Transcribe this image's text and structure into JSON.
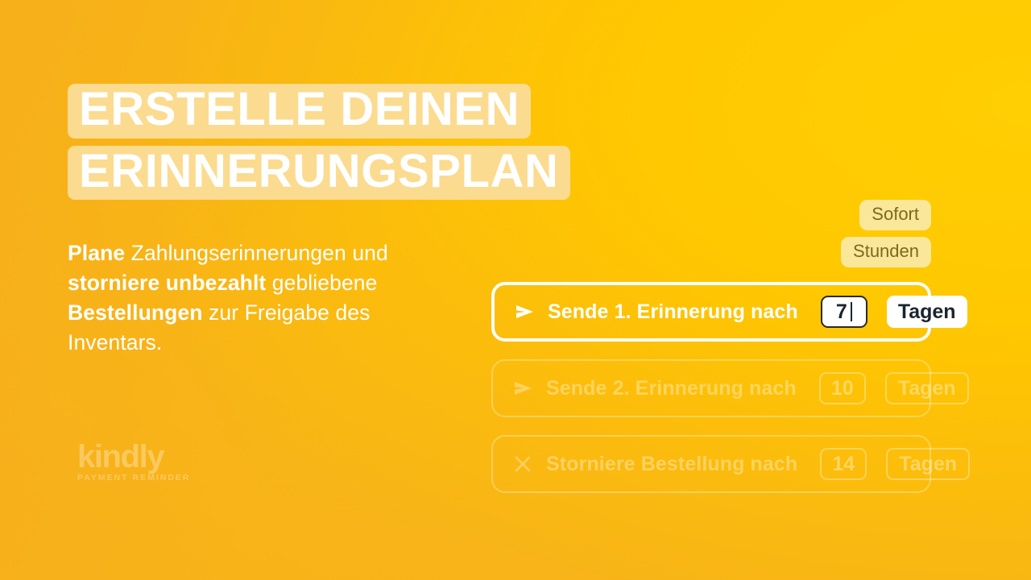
{
  "theme": {
    "bg_from": "#F7B11B",
    "bg_to": "#FFCE03",
    "highlight": "#FBDB8F",
    "chip_bg": "#FAE79A",
    "chip_text": "#7C6A1B",
    "text_on_white": "#1C2430",
    "white": "#FFFFFF"
  },
  "headline": {
    "line1": "Erstelle deinen",
    "line2": "Erinnerungsplan"
  },
  "subtitle": {
    "part1": "Plane",
    "part2": " Zahlungserinnerungen und ",
    "part3": "storniere unbezahlt",
    "part4": " gebliebene ",
    "part5": "Bestellungen",
    "part6": " zur Freigabe des Inventars."
  },
  "logo": {
    "word": "kindly",
    "tagline": "PAYMENT REMINDER"
  },
  "chips": [
    {
      "label": "Sofort"
    },
    {
      "label": "Stunden"
    }
  ],
  "rows": [
    {
      "icon": "send-icon",
      "label": "Sende 1. Erinnerung nach",
      "value": "7",
      "unit": "Tagen",
      "state": "active"
    },
    {
      "icon": "send-icon",
      "label": "Sende 2. Erinnerung nach",
      "value": "10",
      "unit": "Tagen",
      "state": "dim"
    },
    {
      "icon": "close-icon",
      "label": "Storniere Bestellung nach",
      "value": "14",
      "unit": "Tagen",
      "state": "dim"
    }
  ]
}
